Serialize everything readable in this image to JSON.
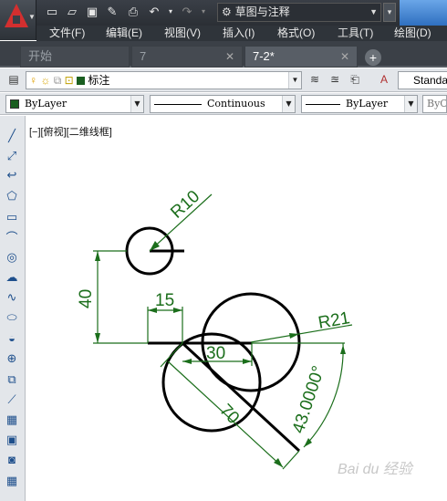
{
  "quick_access": {
    "workspace": "草图与注释"
  },
  "menu": [
    {
      "label": "文件(F)"
    },
    {
      "label": "编辑(E)"
    },
    {
      "label": "视图(V)"
    },
    {
      "label": "插入(I)"
    },
    {
      "label": "格式(O)"
    },
    {
      "label": "工具(T)"
    },
    {
      "label": "绘图(D)"
    }
  ],
  "tabs": [
    {
      "label": "开始"
    },
    {
      "label": "7"
    },
    {
      "label": "7-2*"
    }
  ],
  "layer_toolbar": {
    "layer_name": "标注",
    "text_style": "Standa"
  },
  "properties_toolbar": {
    "color": "ByLayer",
    "linetype": "Continuous",
    "lineweight": "ByLayer",
    "plot_style": "ByC"
  },
  "viewport": {
    "label": "[−][俯视][二维线框]"
  },
  "drawing": {
    "dimension_radius_small": "R10",
    "dimension_radius_large": "R21",
    "dimension_vertical": "40",
    "dimension_horizontal_short": "15",
    "dimension_horizontal_long": "30",
    "dimension_aligned": "70",
    "dimension_angle": "43.0000°"
  },
  "watermark": "Bai du 经验",
  "colors": {
    "dimension": "#1b6e1b",
    "geometry": "#000000",
    "titlebar": "#2f343a",
    "toolbar": "#e3e6ea"
  }
}
